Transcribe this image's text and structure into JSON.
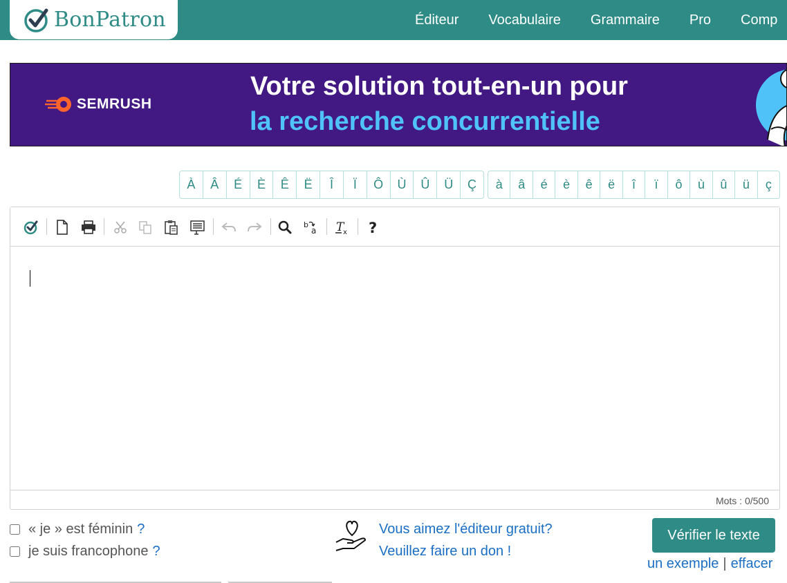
{
  "header": {
    "logo_text": "BonPatron",
    "nav": [
      "Éditeur",
      "Vocabulaire",
      "Grammaire",
      "Pro",
      "Comp"
    ]
  },
  "banner": {
    "brand": "SEMRUSH",
    "line1": "Votre solution tout-en-un pour",
    "line2": "la recherche concurrentielle"
  },
  "accents": {
    "upper": [
      "À",
      "Â",
      "É",
      "È",
      "Ê",
      "Ë",
      "Î",
      "Ï",
      "Ô",
      "Ù",
      "Û",
      "Ü",
      "Ç"
    ],
    "lower": [
      "à",
      "â",
      "é",
      "è",
      "ê",
      "ë",
      "î",
      "ï",
      "ô",
      "ù",
      "û",
      "ü",
      "ç"
    ]
  },
  "editor": {
    "toolbar": [
      {
        "name": "check-icon"
      },
      {
        "name": "new-document-icon"
      },
      {
        "name": "print-icon"
      },
      {
        "name": "cut-icon"
      },
      {
        "name": "copy-icon"
      },
      {
        "name": "paste-icon"
      },
      {
        "name": "paste-text-icon"
      },
      {
        "name": "undo-icon"
      },
      {
        "name": "redo-icon"
      },
      {
        "name": "find-icon"
      },
      {
        "name": "replace-icon"
      },
      {
        "name": "remove-format-icon"
      },
      {
        "name": "help-icon"
      }
    ],
    "word_count": "Mots : 0/500"
  },
  "options": {
    "feminine_label": "« je » est féminin",
    "francophone_label": "je suis francophone",
    "help": "?"
  },
  "donation": {
    "line1": "Vous aimez l'éditeur gratuit?",
    "line2": "Veuillez faire un don !"
  },
  "actions": {
    "verify": "Vérifier le texte",
    "example": "un exemple",
    "separator": "|",
    "clear": "effacer"
  },
  "colors": {
    "brand": "#2e8b86",
    "banner_bg": "#421983",
    "banner_accent": "#4fc3f7",
    "link": "#1a6fc4"
  }
}
